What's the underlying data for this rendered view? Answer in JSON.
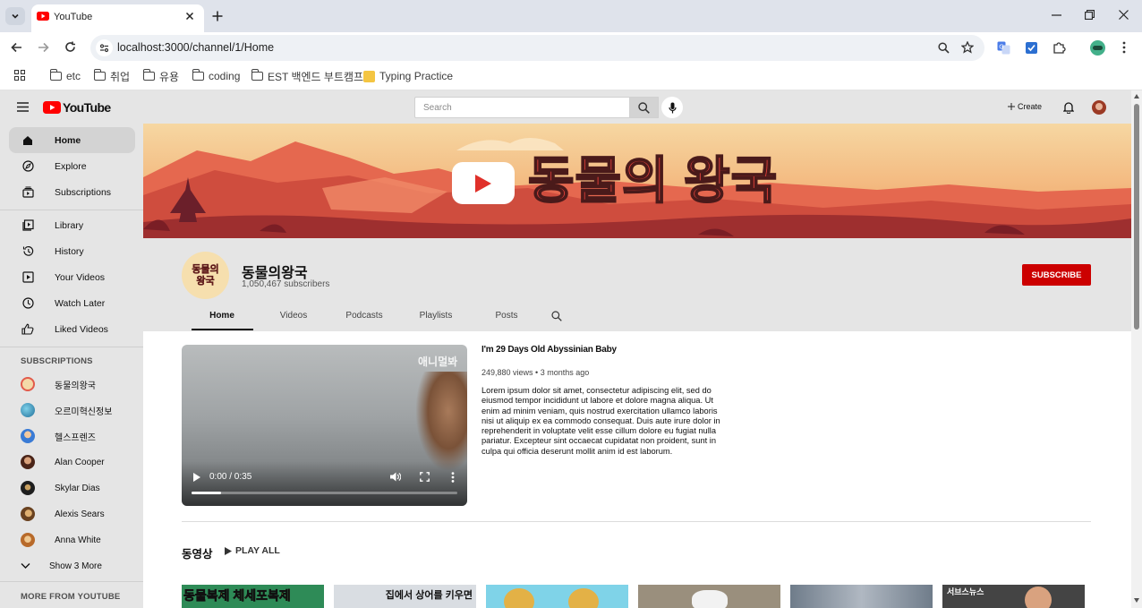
{
  "browser": {
    "tab_title": "YouTube",
    "url": "localhost:3000/channel/1/Home",
    "bookmarks": [
      "etc",
      "취업",
      "유용",
      "coding",
      "EST 백엔드 부트캠프",
      "Typing Practice"
    ]
  },
  "topbar": {
    "logo_text": "YouTube",
    "search_placeholder": "Search",
    "create_label": "Create"
  },
  "sidebar": {
    "main_items": [
      {
        "label": "Home",
        "icon": "home-icon",
        "active": true
      },
      {
        "label": "Explore",
        "icon": "compass-icon"
      },
      {
        "label": "Subscriptions",
        "icon": "subscriptions-icon"
      }
    ],
    "library_items": [
      {
        "label": "Library",
        "icon": "library-icon"
      },
      {
        "label": "History",
        "icon": "history-icon"
      },
      {
        "label": "Your Videos",
        "icon": "your-videos-icon"
      },
      {
        "label": "Watch Later",
        "icon": "clock-icon"
      },
      {
        "label": "Liked Videos",
        "icon": "thumbs-up-icon"
      }
    ],
    "subscriptions_heading": "SUBSCRIPTIONS",
    "subscriptions": [
      {
        "name": "동물의왕국",
        "color": "#f4d9a8"
      },
      {
        "name": "오르미혁신정보",
        "color": "#2a8fb6"
      },
      {
        "name": "헬스프렌즈",
        "color": "#3a7bd5"
      },
      {
        "name": "Alan Cooper",
        "color": "#6b3a2a"
      },
      {
        "name": "Skylar Dias",
        "color": "#2b2b2b"
      },
      {
        "name": "Alexis Sears",
        "color": "#8c5a2b"
      },
      {
        "name": "Anna White",
        "color": "#c8903a"
      }
    ],
    "show_more_label": "Show 3 More",
    "more_heading": "MORE FROM YOUTUBE"
  },
  "banner": {
    "title_text": "동물의 왕국"
  },
  "channel": {
    "avatar_text": "동물의\n왕국",
    "name": "동물의왕국",
    "subscribers": "1,050,467 subscribers",
    "subscribe_label": "SUBSCRIBE",
    "tabs": [
      "Home",
      "Videos",
      "Podcasts",
      "Playlists",
      "Posts"
    ],
    "active_tab": "Home"
  },
  "featured": {
    "title": "I'm 29 Days Old Abyssinian Baby",
    "meta": "249,880 views • 3 months ago",
    "description": "Lorem ipsum dolor sit amet, consectetur adipiscing elit, sed do eiusmod tempor incididunt ut labore et dolore magna aliqua. Ut enim ad minim veniam, quis nostrud exercitation ullamco laboris nisi ut aliquip ex ea commodo consequat. Duis aute irure dolor in reprehenderit in voluptate velit esse cillum dolore eu fugiat nulla pariatur. Excepteur sint occaecat cupidatat non proident, sunt in culpa qui officia deserunt mollit anim id est laborum.",
    "player_time": "0:00 / 0:35",
    "watermark": "애니멀봐",
    "progress_fraction": 0.11
  },
  "section": {
    "title": "동영상",
    "play_all_label": "PLAY ALL"
  },
  "thumbnails": [
    {
      "caption": "동물복제 체세포복제",
      "bg": "#2e8b57",
      "fg": "#ffeb3b"
    },
    {
      "caption": "집에서 상어를 키우면",
      "bg": "#d9dde2",
      "fg": "#111111"
    },
    {
      "caption": "",
      "bg": "#7fd3e8",
      "fg": "#ffffff"
    },
    {
      "caption": "",
      "bg": "#9a8f7d",
      "fg": "#ffffff"
    },
    {
      "caption": "",
      "bg": "#8c98a6",
      "fg": "#ffffff"
    },
    {
      "caption": "",
      "bg": "#c7c2bb",
      "fg": "#ffffff"
    },
    {
      "caption": "서브스뉴스",
      "bg": "#444444",
      "fg": "#ffffff"
    }
  ]
}
